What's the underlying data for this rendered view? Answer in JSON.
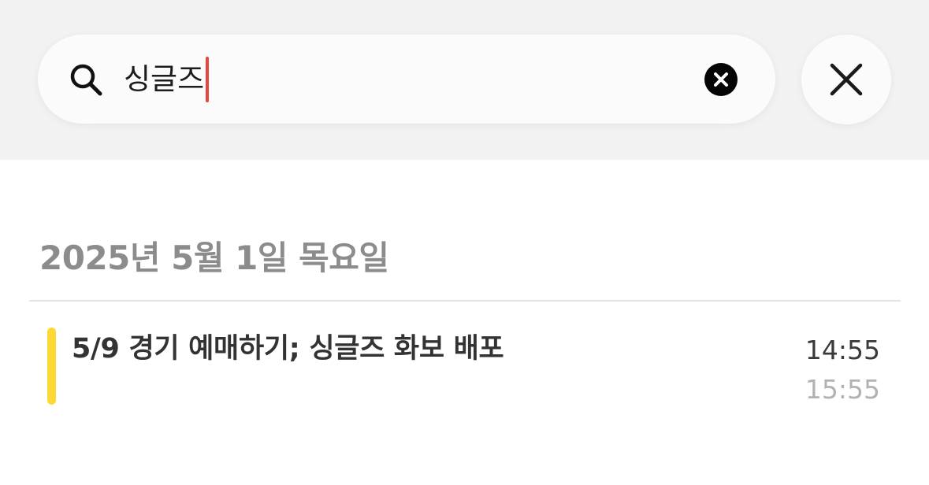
{
  "search": {
    "query": "싱글즈",
    "icon": "search-icon",
    "clear_icon": "clear-icon",
    "close_icon": "close-icon"
  },
  "results": {
    "date_heading": "2025년 5월 1일 목요일",
    "events": [
      {
        "title": "5/9 경기 예매하기; 싱글즈 화보 배포",
        "start_time": "14:55",
        "end_time": "15:55",
        "color": "#FDD935"
      }
    ]
  },
  "colors": {
    "caret": "#E8453C",
    "header_bg": "#F2F2F2",
    "date_heading": "#8C8C8C"
  }
}
